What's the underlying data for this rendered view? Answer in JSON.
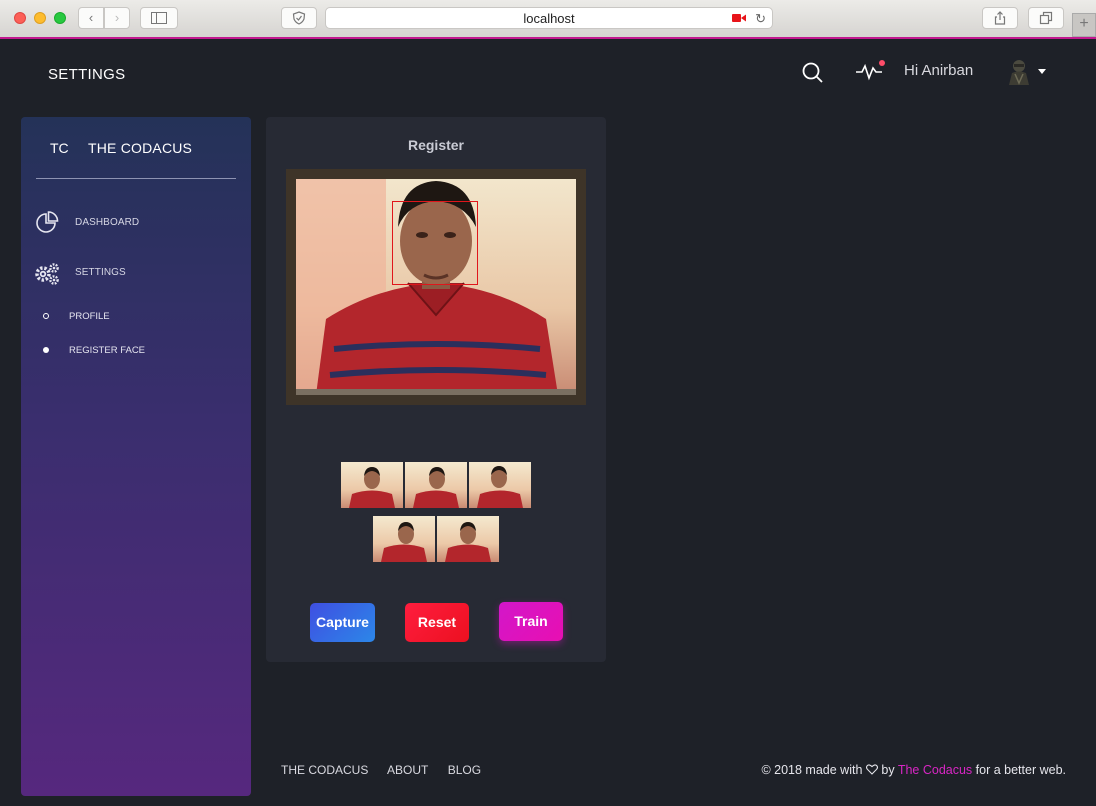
{
  "browser": {
    "url": "localhost",
    "icons": [
      "back-arrow-icon",
      "forward-arrow-icon",
      "sidebar-toggle-icon",
      "shield-icon",
      "camera-recording-icon",
      "reload-icon",
      "share-icon",
      "tabs-icon",
      "new-tab-plus-icon"
    ]
  },
  "header": {
    "title": "SETTINGS",
    "greeting": "Hi Anirban",
    "notification_color": "#ff4d6a"
  },
  "sidebar": {
    "brand_abbr": "TC",
    "brand_name": "THE CODACUS",
    "items": [
      {
        "label": "DASHBOARD",
        "icon": "pie-chart-icon"
      },
      {
        "label": "SETTINGS",
        "icon": "gears-icon"
      }
    ],
    "subitems": [
      {
        "label": "PROFILE",
        "active": false
      },
      {
        "label": "REGISTER FACE",
        "active": true
      }
    ]
  },
  "register": {
    "title": "Register",
    "thumbnail_count": 5,
    "buttons": {
      "capture": "Capture",
      "reset": "Reset",
      "train": "Train"
    }
  },
  "footer": {
    "links": [
      "THE CODACUS",
      "ABOUT",
      "BLOG"
    ],
    "copy_prefix": "© 2018 made with",
    "copy_by": "by",
    "copy_brand": "The Codacus",
    "copy_suffix": "for a better web.",
    "brand_color": "#d826c4"
  }
}
